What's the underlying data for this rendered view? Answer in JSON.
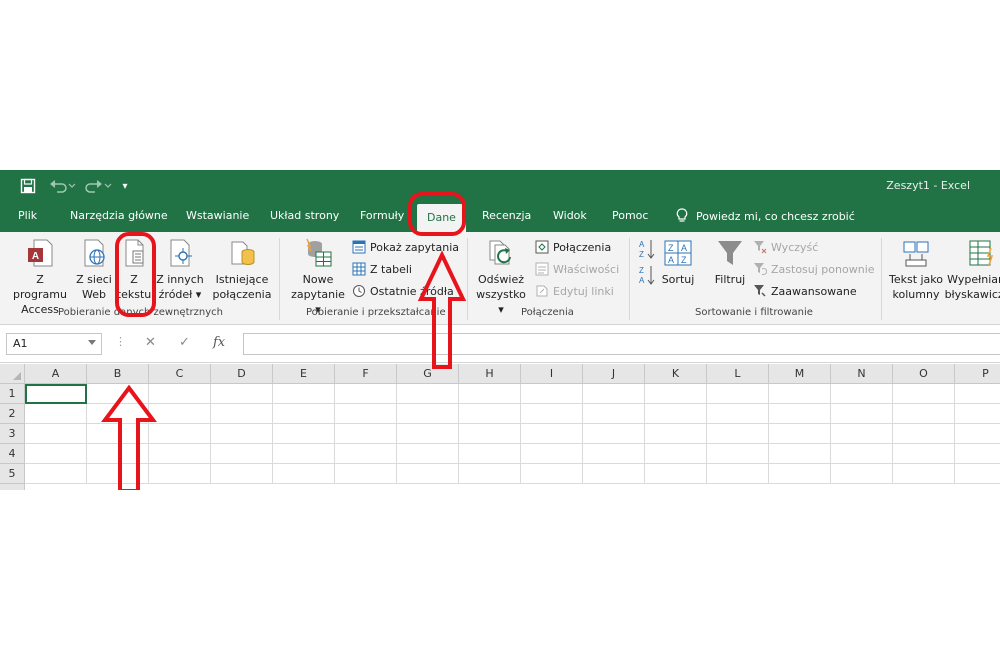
{
  "window": {
    "title": "Zeszyt1  -  Excel"
  },
  "quick_access": {
    "save": "save-icon",
    "undo": "undo-icon",
    "redo": "redo-icon",
    "customize": "▾"
  },
  "tabs": [
    {
      "label": "Plik"
    },
    {
      "label": "Narzędzia główne"
    },
    {
      "label": "Wstawianie"
    },
    {
      "label": "Układ strony"
    },
    {
      "label": "Formuły"
    },
    {
      "label": "Dane"
    },
    {
      "label": "Recenzja"
    },
    {
      "label": "Widok"
    },
    {
      "label": "Pomoc"
    }
  ],
  "active_tab": "Dane",
  "tell_me": "Powiedz mi, co chcesz zrobić",
  "ribbon": {
    "get_external": {
      "label": "Pobieranie danych zewnętrznych",
      "access_l1": "Z programu",
      "access_l2": "Access",
      "web_l1": "Z sieci",
      "web_l2": "Web",
      "text_l1": "Z",
      "text_l2": "tekstu",
      "other_l1": "Z innych",
      "other_l2": "źródeł",
      "existing_l1": "Istniejące",
      "existing_l2": "połączenia"
    },
    "get_transform": {
      "label": "Pobieranie i przekształcanie",
      "new_l1": "Nowe",
      "new_l2": "zapytanie",
      "show_queries": "Pokaż zapytania",
      "from_table": "Z tabeli",
      "recent_sources": "Ostatnie źródła"
    },
    "connections": {
      "label": "Połączenia",
      "refresh_l1": "Odśwież",
      "refresh_l2": "wszystko",
      "connections": "Połączenia",
      "properties": "Właściwości",
      "edit_links": "Edytuj linki"
    },
    "sort_filter": {
      "label": "Sortowanie i filtrowanie",
      "sort": "Sortuj",
      "filter": "Filtruj",
      "clear": "Wyczyść",
      "reapply": "Zastosuj ponownie",
      "advanced": "Zaawansowane"
    },
    "data_tools": {
      "text_to_columns_l1": "Tekst jako",
      "text_to_columns_l2": "kolumny",
      "flash_fill_l1": "Wypełnianie",
      "flash_fill_l2": "błyskawiczne"
    }
  },
  "formula_bar": {
    "name_box": "A1",
    "cancel": "✕",
    "enter": "✓",
    "fx": "fx",
    "value": ""
  },
  "grid": {
    "columns": [
      "A",
      "B",
      "C",
      "D",
      "E",
      "F",
      "G",
      "H",
      "I",
      "J",
      "K",
      "L",
      "M",
      "N",
      "O",
      "P"
    ],
    "rows": [
      "1",
      "2",
      "3",
      "4",
      "5"
    ]
  },
  "colors": {
    "accent": "#217346",
    "annotation": "#e8141b"
  }
}
